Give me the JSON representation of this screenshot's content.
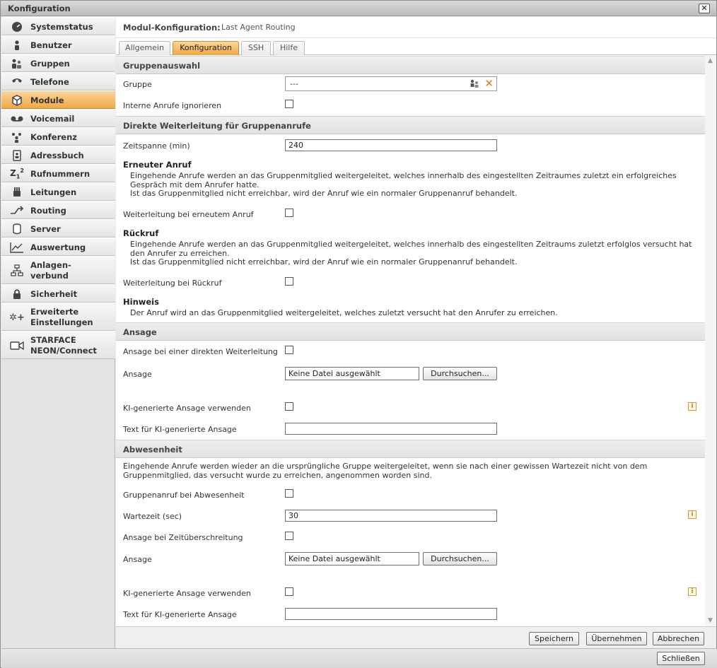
{
  "window": {
    "title": "Konfiguration",
    "close_label": "✕"
  },
  "sidebar": {
    "items": [
      {
        "label": "Systemstatus",
        "icon": "gauge-icon"
      },
      {
        "label": "Benutzer",
        "icon": "user-icon"
      },
      {
        "label": "Gruppen",
        "icon": "group-icon"
      },
      {
        "label": "Telefone",
        "icon": "phone-icon"
      },
      {
        "label": "Module",
        "icon": "cube-icon"
      },
      {
        "label": "Voicemail",
        "icon": "voicemail-icon"
      },
      {
        "label": "Konferenz",
        "icon": "conference-icon"
      },
      {
        "label": "Adressbuch",
        "icon": "addressbook-icon"
      },
      {
        "label": "Rufnummern",
        "icon": "number-icon"
      },
      {
        "label": "Leitungen",
        "icon": "line-icon"
      },
      {
        "label": "Routing",
        "icon": "routing-icon"
      },
      {
        "label": "Server",
        "icon": "server-icon"
      },
      {
        "label": "Auswertung",
        "icon": "chart-icon"
      },
      {
        "label": "Anlagen-\nverbund",
        "icon": "network-icon"
      },
      {
        "label": "Sicherheit",
        "icon": "lock-icon"
      },
      {
        "label": "Erweiterte\nEinstellungen",
        "icon": "advanced-settings-icon"
      },
      {
        "label": "STARFACE\nNEON/Connect",
        "icon": "camera-icon"
      }
    ],
    "active_index": 4
  },
  "module_header": {
    "label": "Modul-Konfiguration:",
    "value": "Last Agent Routing"
  },
  "tabs": [
    {
      "label": "Allgemein"
    },
    {
      "label": "Konfiguration"
    },
    {
      "label": "SSH"
    },
    {
      "label": "Hilfe"
    }
  ],
  "active_tab": 1,
  "sections": {
    "gruppenauswahl": {
      "title": "Gruppenauswahl",
      "gruppe_label": "Gruppe",
      "gruppe_value": "---",
      "interne_label": "Interne Anrufe ignorieren"
    },
    "direkte": {
      "title": "Direkte Weiterleitung für Gruppenanrufe",
      "zeitspanne_label": "Zeitspanne (min)",
      "zeitspanne_value": "240",
      "erneuter_title": "Erneuter Anruf",
      "erneuter_desc1": "Eingehende Anrufe werden an das Gruppenmitglied weitergeleitet, welches innerhalb des eingestellten Zeitraumes zuletzt ein erfolgreiches",
      "erneuter_desc2": "Gespräch mit dem Anrufer hatte.",
      "erneuter_desc3": "Ist das Gruppenmitglied nicht erreichbar, wird der Anruf wie ein normaler Gruppenanruf behandelt.",
      "erneuter_cb_label": "Weiterleitung bei erneutem Anruf",
      "rueckruf_title": "Rückruf",
      "rueckruf_desc1": "Eingehende Anrufe werden an das Gruppenmitglied weitergeleitet, welches innerhalb des eingestellten Zeitraums zuletzt erfolglos versucht hat",
      "rueckruf_desc2": "den Anrufer zu erreichen.",
      "rueckruf_desc3": "Ist das Gruppenmitglied nicht erreichbar, wird der Anruf wie ein normaler Gruppenanruf behandelt.",
      "rueckruf_cb_label": "Weiterleitung bei Rückruf",
      "hinweis_title": "Hinweis",
      "hinweis_desc": "Der Anruf wird an das Gruppenmitglied weitergeleitet, welches zuletzt versucht hat den Anrufer zu erreichen."
    },
    "ansage": {
      "title": "Ansage",
      "direkt_label": "Ansage bei einer direkten Weiterleitung",
      "ansage_label": "Ansage",
      "file_value": "Keine Datei ausgewählt",
      "browse_label": "Durchsuchen...",
      "ki_label": "KI-generierte Ansage verwenden",
      "ki_text_label": "Text für KI-generierte Ansage",
      "ki_text_value": ""
    },
    "abwesenheit": {
      "title": "Abwesenheit",
      "desc1": "Eingehende Anrufe werden wieder an die ursprüngliche Gruppe weitergeleitet, wenn sie nach einer gewissen Wartezeit nicht von dem",
      "desc2": "Gruppenmitglied, das versucht wurde zu erreichen, angenommen worden sind.",
      "gruppenanruf_label": "Gruppenanruf bei Abwesenheit",
      "wartezeit_label": "Wartezeit (sec)",
      "wartezeit_value": "30",
      "zeitueberschreitung_label": "Ansage bei Zeitüberschreitung",
      "ansage_label": "Ansage",
      "file_value": "Keine Datei ausgewählt",
      "browse_label": "Durchsuchen...",
      "ki_label": "KI-generierte Ansage verwenden",
      "ki_text_label": "Text für KI-generierte Ansage",
      "ki_text_value": ""
    }
  },
  "info_icon": "i",
  "buttons": {
    "save": "Speichern",
    "apply": "Übernehmen",
    "cancel": "Abbrechen",
    "close": "Schließen"
  }
}
